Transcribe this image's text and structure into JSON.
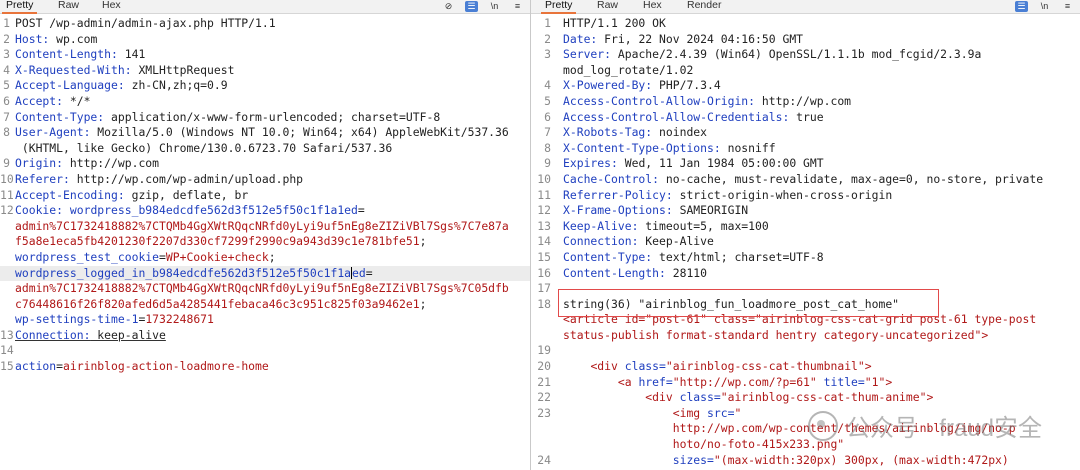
{
  "request": {
    "tabs": [
      "Pretty",
      "Raw",
      "Hex"
    ],
    "icons": [
      "eye-slash-icon",
      "wrap-icon",
      "newline-icon",
      "menu-icon"
    ],
    "lines": [
      {
        "n": "1",
        "parts": [
          {
            "t": "POST /wp-admin/admin-ajax.php HTTP/1.1",
            "c": "v"
          }
        ]
      },
      {
        "n": "2",
        "parts": [
          {
            "t": "Host:",
            "c": "k"
          },
          {
            "t": " wp.com",
            "c": "v"
          }
        ]
      },
      {
        "n": "3",
        "parts": [
          {
            "t": "Content-Length:",
            "c": "k"
          },
          {
            "t": " 141",
            "c": "v"
          }
        ]
      },
      {
        "n": "4",
        "parts": [
          {
            "t": "X-Requested-With:",
            "c": "k"
          },
          {
            "t": " XMLHttpRequest",
            "c": "v"
          }
        ]
      },
      {
        "n": "5",
        "parts": [
          {
            "t": "Accept-Language:",
            "c": "k"
          },
          {
            "t": " zh-CN,zh;q=0.9",
            "c": "v"
          }
        ]
      },
      {
        "n": "6",
        "parts": [
          {
            "t": "Accept:",
            "c": "k"
          },
          {
            "t": " */*",
            "c": "v"
          }
        ]
      },
      {
        "n": "7",
        "parts": [
          {
            "t": "Content-Type:",
            "c": "k"
          },
          {
            "t": " application/x-www-form-urlencoded; charset=UTF-8",
            "c": "v"
          }
        ]
      },
      {
        "n": "8",
        "parts": [
          {
            "t": "User-Agent:",
            "c": "k"
          },
          {
            "t": " Mozilla/5.0 (Windows NT 10.0; Win64; x64) AppleWebKit/537.36",
            "c": "v"
          }
        ]
      },
      {
        "n": "",
        "parts": [
          {
            "t": " (KHTML, like Gecko) Chrome/130.0.6723.70 Safari/537.36",
            "c": "v"
          }
        ]
      },
      {
        "n": "9",
        "parts": [
          {
            "t": "Origin:",
            "c": "k"
          },
          {
            "t": " http://wp.com",
            "c": "v"
          }
        ]
      },
      {
        "n": "10",
        "parts": [
          {
            "t": "Referer:",
            "c": "k"
          },
          {
            "t": " http://wp.com/wp-admin/upload.php",
            "c": "v"
          }
        ]
      },
      {
        "n": "11",
        "parts": [
          {
            "t": "Accept-Encoding:",
            "c": "k"
          },
          {
            "t": " gzip, deflate, br",
            "c": "v"
          }
        ]
      },
      {
        "n": "12",
        "parts": [
          {
            "t": "Cookie:",
            "c": "k"
          },
          {
            "t": " wordpress_b984edcdfe562d3f512e5f50c1f1a1ed",
            "c": "k"
          },
          {
            "t": "=",
            "c": "v"
          }
        ]
      },
      {
        "n": "",
        "parts": [
          {
            "t": "admin%7C1732418882%7CTQMb4GgXWtRQqcNRfd0yLyi9uf5nEg8eZIZiVBl7Sgs%7C7e87a",
            "c": "red"
          }
        ]
      },
      {
        "n": "",
        "parts": [
          {
            "t": "f5a8e1eca5fb4201230f2207d330cf7299f2990c9a943d39c1e781bfe51",
            "c": "red"
          },
          {
            "t": ";",
            "c": "v"
          }
        ]
      },
      {
        "n": "",
        "parts": [
          {
            "t": "wordpress_test_cookie",
            "c": "k"
          },
          {
            "t": "=",
            "c": "v"
          },
          {
            "t": "WP+Cookie+check",
            "c": "red"
          },
          {
            "t": ";",
            "c": "v"
          }
        ]
      },
      {
        "n": "",
        "hl": true,
        "parts": [
          {
            "t": "wordpress_logged_in_b984edcdfe562d3f512e5f50c1f1a",
            "c": "k"
          },
          {
            "t": "|",
            "c": "cursor"
          },
          {
            "t": "ed",
            "c": "k"
          },
          {
            "t": "=",
            "c": "v"
          }
        ]
      },
      {
        "n": "",
        "parts": [
          {
            "t": "admin%7C1732418882%7CTQMb4GgXWtRQqcNRfd0yLyi9uf5nEg8eZIZiVBl7Sgs%7C05dfb",
            "c": "red"
          }
        ]
      },
      {
        "n": "",
        "parts": [
          {
            "t": "c76448616f26f820afed6d5a4285441febaca46c3c951c825f03a9462e1",
            "c": "red"
          },
          {
            "t": ";",
            "c": "v"
          }
        ]
      },
      {
        "n": "",
        "parts": [
          {
            "t": "wp-settings-time-1",
            "c": "k"
          },
          {
            "t": "=",
            "c": "v"
          },
          {
            "t": "1732248671",
            "c": "red"
          }
        ]
      },
      {
        "n": "13",
        "parts": [
          {
            "t": "Connection:",
            "c": "k ul"
          },
          {
            "t": " keep-alive",
            "c": "v ul"
          }
        ]
      },
      {
        "n": "14",
        "parts": []
      },
      {
        "n": "15",
        "parts": [
          {
            "t": "action",
            "c": "k"
          },
          {
            "t": "=",
            "c": "v"
          },
          {
            "t": "airinblog-action-loadmore-home",
            "c": "red"
          }
        ]
      }
    ]
  },
  "response": {
    "tabs": [
      "Pretty",
      "Raw",
      "Hex",
      "Render"
    ],
    "icons": [
      "wrap-icon",
      "newline-icon",
      "menu-icon"
    ],
    "lines": [
      {
        "n": "1",
        "parts": [
          {
            "t": "HTTP/1.1 200 OK",
            "c": "v"
          }
        ]
      },
      {
        "n": "2",
        "parts": [
          {
            "t": "Date:",
            "c": "k"
          },
          {
            "t": " Fri, 22 Nov 2024 04:16:50 GMT",
            "c": "v"
          }
        ]
      },
      {
        "n": "3",
        "parts": [
          {
            "t": "Server:",
            "c": "k"
          },
          {
            "t": " Apache/2.4.39 (Win64) OpenSSL/1.1.1b mod_fcgid/2.3.9a",
            "c": "v"
          }
        ]
      },
      {
        "n": "",
        "parts": [
          {
            "t": "mod_log_rotate/1.02",
            "c": "v"
          }
        ]
      },
      {
        "n": "4",
        "parts": [
          {
            "t": "X-Powered-By:",
            "c": "k"
          },
          {
            "t": " PHP/7.3.4",
            "c": "v"
          }
        ]
      },
      {
        "n": "5",
        "parts": [
          {
            "t": "Access-Control-Allow-Origin:",
            "c": "k"
          },
          {
            "t": " http://wp.com",
            "c": "v"
          }
        ]
      },
      {
        "n": "6",
        "parts": [
          {
            "t": "Access-Control-Allow-Credentials:",
            "c": "k"
          },
          {
            "t": " true",
            "c": "v"
          }
        ]
      },
      {
        "n": "7",
        "parts": [
          {
            "t": "X-Robots-Tag:",
            "c": "k"
          },
          {
            "t": " noindex",
            "c": "v"
          }
        ]
      },
      {
        "n": "8",
        "parts": [
          {
            "t": "X-Content-Type-Options:",
            "c": "k"
          },
          {
            "t": " nosniff",
            "c": "v"
          }
        ]
      },
      {
        "n": "9",
        "parts": [
          {
            "t": "Expires:",
            "c": "k"
          },
          {
            "t": " Wed, 11 Jan 1984 05:00:00 GMT",
            "c": "v"
          }
        ]
      },
      {
        "n": "10",
        "parts": [
          {
            "t": "Cache-Control:",
            "c": "k"
          },
          {
            "t": " no-cache, must-revalidate, max-age=0, no-store, private",
            "c": "v"
          }
        ]
      },
      {
        "n": "11",
        "parts": [
          {
            "t": "Referrer-Policy:",
            "c": "k"
          },
          {
            "t": " strict-origin-when-cross-origin",
            "c": "v"
          }
        ]
      },
      {
        "n": "12",
        "parts": [
          {
            "t": "X-Frame-Options:",
            "c": "k"
          },
          {
            "t": " SAMEORIGIN",
            "c": "v"
          }
        ]
      },
      {
        "n": "13",
        "parts": [
          {
            "t": "Keep-Alive:",
            "c": "k"
          },
          {
            "t": " timeout=5, max=100",
            "c": "v"
          }
        ]
      },
      {
        "n": "14",
        "parts": [
          {
            "t": "Connection:",
            "c": "k"
          },
          {
            "t": " Keep-Alive",
            "c": "v"
          }
        ]
      },
      {
        "n": "15",
        "parts": [
          {
            "t": "Content-Type:",
            "c": "k"
          },
          {
            "t": " text/html; charset=UTF-8",
            "c": "v"
          }
        ]
      },
      {
        "n": "16",
        "parts": [
          {
            "t": "Content-Length:",
            "c": "k"
          },
          {
            "t": " 28110",
            "c": "v"
          }
        ]
      },
      {
        "n": "17",
        "parts": []
      },
      {
        "n": "18",
        "parts": [
          {
            "t": "string(36) \"airinblog_fun_loadmore_post_cat_home\"",
            "c": "v"
          }
        ]
      },
      {
        "n": "",
        "parts": [
          {
            "t": "<article id=\"post-61\" class=\"airinblog-css-cat-grid post-61 type-post",
            "c": "tag"
          }
        ]
      },
      {
        "n": "",
        "parts": [
          {
            "t": "status-publish format-standard hentry category-uncategorized\">",
            "c": "tag"
          }
        ]
      },
      {
        "n": "19",
        "parts": []
      },
      {
        "n": "20",
        "parts": [
          {
            "t": "    ",
            "c": "v"
          },
          {
            "t": "<div ",
            "c": "tag"
          },
          {
            "t": "class=",
            "c": "k"
          },
          {
            "t": "\"airinblog-css-cat-thumbnail\"",
            "c": "str"
          },
          {
            "t": ">",
            "c": "tag"
          }
        ]
      },
      {
        "n": "21",
        "parts": [
          {
            "t": "        ",
            "c": "v"
          },
          {
            "t": "<a ",
            "c": "tag"
          },
          {
            "t": "href=",
            "c": "k"
          },
          {
            "t": "\"http://wp.com/?p=61\" ",
            "c": "str"
          },
          {
            "t": "title=",
            "c": "k"
          },
          {
            "t": "\"1\"",
            "c": "str"
          },
          {
            "t": ">",
            "c": "tag"
          }
        ]
      },
      {
        "n": "22",
        "parts": [
          {
            "t": "            ",
            "c": "v"
          },
          {
            "t": "<div ",
            "c": "tag"
          },
          {
            "t": "class=",
            "c": "k"
          },
          {
            "t": "\"airinblog-css-cat-thum-anime\"",
            "c": "str"
          },
          {
            "t": ">",
            "c": "tag"
          }
        ]
      },
      {
        "n": "23",
        "parts": [
          {
            "t": "                ",
            "c": "v"
          },
          {
            "t": "<img ",
            "c": "tag"
          },
          {
            "t": "src=",
            "c": "k"
          },
          {
            "t": "\"",
            "c": "str"
          }
        ]
      },
      {
        "n": "",
        "parts": [
          {
            "t": "                http://wp.com/wp-content/themes/airinblog/img/no-p",
            "c": "str"
          }
        ]
      },
      {
        "n": "",
        "parts": [
          {
            "t": "                hoto/no-foto-415x233.png\"",
            "c": "str"
          }
        ]
      },
      {
        "n": "24",
        "parts": [
          {
            "t": "                ",
            "c": "v"
          },
          {
            "t": "sizes=",
            "c": "k"
          },
          {
            "t": "\"(max-width:320px) 300px, (max-width:472px)",
            "c": "str"
          }
        ]
      }
    ]
  },
  "watermark": {
    "text": "公众号 · fraud安全"
  }
}
